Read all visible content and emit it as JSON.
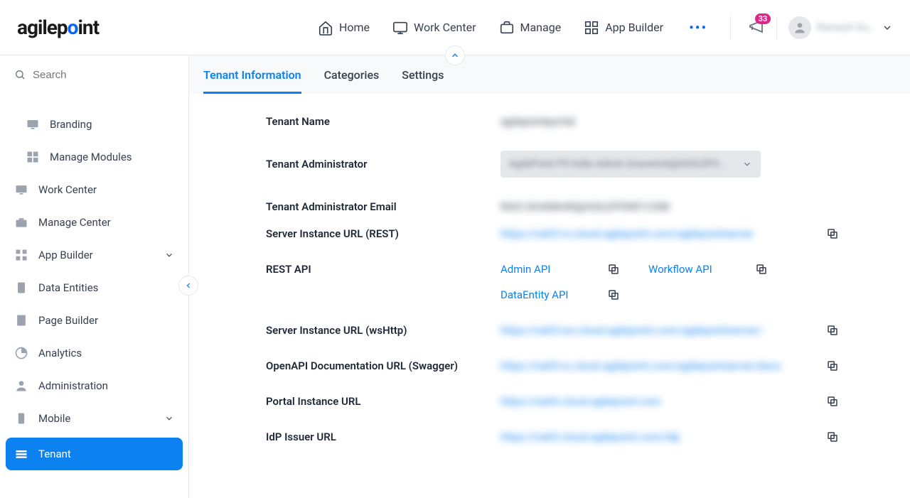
{
  "header": {
    "nav": {
      "home": "Home",
      "workcenter": "Work Center",
      "manage": "Manage",
      "appbuilder": "App Builder"
    },
    "badge": "33",
    "username": "Ramesh Gu..."
  },
  "sidebar": {
    "searchPlaceholder": "Search",
    "items": {
      "branding": "Branding",
      "modules": "Manage Modules",
      "workcenter": "Work Center",
      "managecenter": "Manage Center",
      "appbuilder": "App Builder",
      "dataentities": "Data Entities",
      "pagebuilder": "Page Builder",
      "analytics": "Analytics",
      "administration": "Administration",
      "mobile": "Mobile",
      "tenant": "Tenant"
    }
  },
  "tabs": {
    "info": "Tenant Information",
    "categories": "Categories",
    "settings": "Settings"
  },
  "fields": {
    "tenantName": {
      "label": "Tenant Name",
      "value": "agilepointportal"
    },
    "tenantAdmin": {
      "label": "Tenant Administrator",
      "value": "AgilePoint PS India Admin (maverick@AGILEPO..."
    },
    "tenantEmail": {
      "label": "Tenant Administrator Email",
      "value": "RAVI.SHANKAR@AGILEPOINT.COM"
    },
    "restUrl": {
      "label": "Server Instance URL (REST)",
      "value": "https://na03-rs.cloud.agilepoint.com/agilepointserver"
    },
    "restApi": {
      "label": "REST API",
      "admin": "Admin API",
      "workflow": "Workflow API",
      "dataentity": "DataEntity API"
    },
    "wshttp": {
      "label": "Server Instance URL (wsHttp)",
      "value": "https://na03-ws.cloud.agilepoint.com/agilepointserver/"
    },
    "swagger": {
      "label": "OpenAPI Documentation URL (Swagger)",
      "value": "https://na03-rs.cloud.agilepoint.com/agilepointserver/docs"
    },
    "portal": {
      "label": "Portal Instance URL",
      "value": "https://na03.cloud.agilepoint.com"
    },
    "idp": {
      "label": "IdP Issuer URL",
      "value": "https://na03.cloud.agilepoint.com/idp"
    }
  }
}
